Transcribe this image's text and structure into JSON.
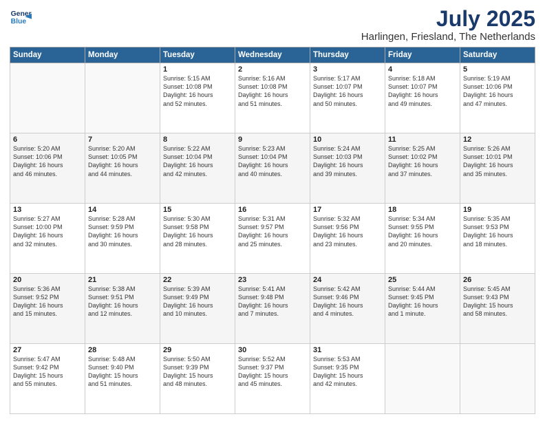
{
  "header": {
    "logo_line1": "General",
    "logo_line2": "Blue",
    "month": "July 2025",
    "location": "Harlingen, Friesland, The Netherlands"
  },
  "days_of_week": [
    "Sunday",
    "Monday",
    "Tuesday",
    "Wednesday",
    "Thursday",
    "Friday",
    "Saturday"
  ],
  "weeks": [
    [
      {
        "day": "",
        "text": ""
      },
      {
        "day": "",
        "text": ""
      },
      {
        "day": "1",
        "text": "Sunrise: 5:15 AM\nSunset: 10:08 PM\nDaylight: 16 hours\nand 52 minutes."
      },
      {
        "day": "2",
        "text": "Sunrise: 5:16 AM\nSunset: 10:08 PM\nDaylight: 16 hours\nand 51 minutes."
      },
      {
        "day": "3",
        "text": "Sunrise: 5:17 AM\nSunset: 10:07 PM\nDaylight: 16 hours\nand 50 minutes."
      },
      {
        "day": "4",
        "text": "Sunrise: 5:18 AM\nSunset: 10:07 PM\nDaylight: 16 hours\nand 49 minutes."
      },
      {
        "day": "5",
        "text": "Sunrise: 5:19 AM\nSunset: 10:06 PM\nDaylight: 16 hours\nand 47 minutes."
      }
    ],
    [
      {
        "day": "6",
        "text": "Sunrise: 5:20 AM\nSunset: 10:06 PM\nDaylight: 16 hours\nand 46 minutes."
      },
      {
        "day": "7",
        "text": "Sunrise: 5:20 AM\nSunset: 10:05 PM\nDaylight: 16 hours\nand 44 minutes."
      },
      {
        "day": "8",
        "text": "Sunrise: 5:22 AM\nSunset: 10:04 PM\nDaylight: 16 hours\nand 42 minutes."
      },
      {
        "day": "9",
        "text": "Sunrise: 5:23 AM\nSunset: 10:04 PM\nDaylight: 16 hours\nand 40 minutes."
      },
      {
        "day": "10",
        "text": "Sunrise: 5:24 AM\nSunset: 10:03 PM\nDaylight: 16 hours\nand 39 minutes."
      },
      {
        "day": "11",
        "text": "Sunrise: 5:25 AM\nSunset: 10:02 PM\nDaylight: 16 hours\nand 37 minutes."
      },
      {
        "day": "12",
        "text": "Sunrise: 5:26 AM\nSunset: 10:01 PM\nDaylight: 16 hours\nand 35 minutes."
      }
    ],
    [
      {
        "day": "13",
        "text": "Sunrise: 5:27 AM\nSunset: 10:00 PM\nDaylight: 16 hours\nand 32 minutes."
      },
      {
        "day": "14",
        "text": "Sunrise: 5:28 AM\nSunset: 9:59 PM\nDaylight: 16 hours\nand 30 minutes."
      },
      {
        "day": "15",
        "text": "Sunrise: 5:30 AM\nSunset: 9:58 PM\nDaylight: 16 hours\nand 28 minutes."
      },
      {
        "day": "16",
        "text": "Sunrise: 5:31 AM\nSunset: 9:57 PM\nDaylight: 16 hours\nand 25 minutes."
      },
      {
        "day": "17",
        "text": "Sunrise: 5:32 AM\nSunset: 9:56 PM\nDaylight: 16 hours\nand 23 minutes."
      },
      {
        "day": "18",
        "text": "Sunrise: 5:34 AM\nSunset: 9:55 PM\nDaylight: 16 hours\nand 20 minutes."
      },
      {
        "day": "19",
        "text": "Sunrise: 5:35 AM\nSunset: 9:53 PM\nDaylight: 16 hours\nand 18 minutes."
      }
    ],
    [
      {
        "day": "20",
        "text": "Sunrise: 5:36 AM\nSunset: 9:52 PM\nDaylight: 16 hours\nand 15 minutes."
      },
      {
        "day": "21",
        "text": "Sunrise: 5:38 AM\nSunset: 9:51 PM\nDaylight: 16 hours\nand 12 minutes."
      },
      {
        "day": "22",
        "text": "Sunrise: 5:39 AM\nSunset: 9:49 PM\nDaylight: 16 hours\nand 10 minutes."
      },
      {
        "day": "23",
        "text": "Sunrise: 5:41 AM\nSunset: 9:48 PM\nDaylight: 16 hours\nand 7 minutes."
      },
      {
        "day": "24",
        "text": "Sunrise: 5:42 AM\nSunset: 9:46 PM\nDaylight: 16 hours\nand 4 minutes."
      },
      {
        "day": "25",
        "text": "Sunrise: 5:44 AM\nSunset: 9:45 PM\nDaylight: 16 hours\nand 1 minute."
      },
      {
        "day": "26",
        "text": "Sunrise: 5:45 AM\nSunset: 9:43 PM\nDaylight: 15 hours\nand 58 minutes."
      }
    ],
    [
      {
        "day": "27",
        "text": "Sunrise: 5:47 AM\nSunset: 9:42 PM\nDaylight: 15 hours\nand 55 minutes."
      },
      {
        "day": "28",
        "text": "Sunrise: 5:48 AM\nSunset: 9:40 PM\nDaylight: 15 hours\nand 51 minutes."
      },
      {
        "day": "29",
        "text": "Sunrise: 5:50 AM\nSunset: 9:39 PM\nDaylight: 15 hours\nand 48 minutes."
      },
      {
        "day": "30",
        "text": "Sunrise: 5:52 AM\nSunset: 9:37 PM\nDaylight: 15 hours\nand 45 minutes."
      },
      {
        "day": "31",
        "text": "Sunrise: 5:53 AM\nSunset: 9:35 PM\nDaylight: 15 hours\nand 42 minutes."
      },
      {
        "day": "",
        "text": ""
      },
      {
        "day": "",
        "text": ""
      }
    ]
  ]
}
